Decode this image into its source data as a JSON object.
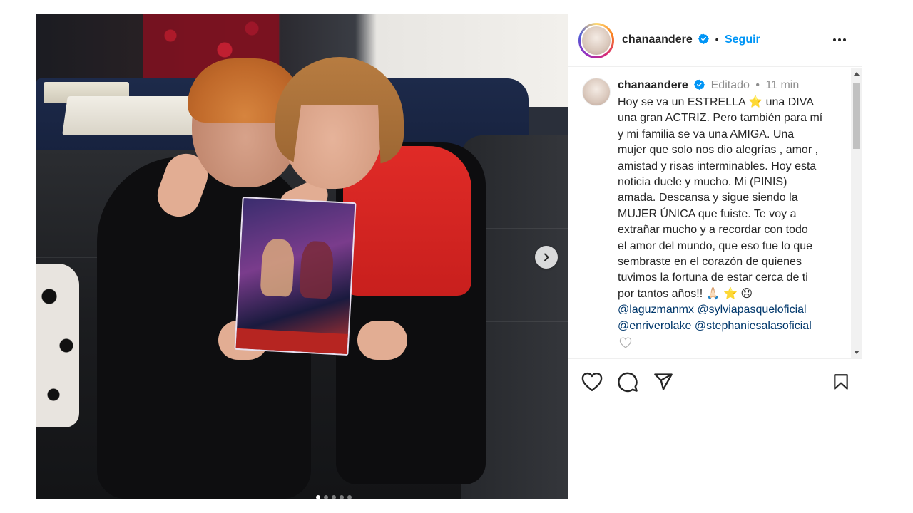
{
  "post": {
    "username": "chanaandere",
    "separator": "•",
    "follow_label": "Seguir",
    "more_icon": "more-options-icon"
  },
  "caption": {
    "username": "chanaandere",
    "edited_label": "Editado",
    "dot": "•",
    "time": "11 min",
    "lines": [
      "Hoy se va un ESTRELLA ⭐  una DIVA",
      "una gran ACTRIZ. Pero también para mí",
      "y mi familia se va una AMIGA. Una",
      "mujer que solo nos dio alegrías , amor ,",
      "amistad y risas interminables. Hoy esta",
      "noticia duele y mucho. Mi (PINIS)",
      "amada. Descansa y sigue siendo la",
      "MUJER ÚNICA que fuiste. Te voy a",
      "extrañar mucho y a recordar con todo",
      "el amor del mundo, que eso fue lo que",
      "sembraste en el corazón de quienes",
      "tuvimos la fortuna de estar cerca de ti",
      "por tantos años!! 🙏🏻 ⭐ 😞"
    ],
    "mentions": [
      [
        "@laguzmanmx",
        "@sylviapasqueloficial"
      ],
      [
        "@enriverolake",
        "@stephaniesalasoficial"
      ]
    ]
  },
  "carousel": {
    "total": 5,
    "active_index": 0
  },
  "colors": {
    "accent": "#0095f6",
    "text": "#262626",
    "muted": "#8e8e8e",
    "mention": "#00376b",
    "verified": "#0095f6"
  },
  "icons": [
    "like-heart-icon",
    "comment-icon",
    "share-icon",
    "save-bookmark-icon",
    "next-arrow-icon",
    "verified-badge-icon"
  ]
}
